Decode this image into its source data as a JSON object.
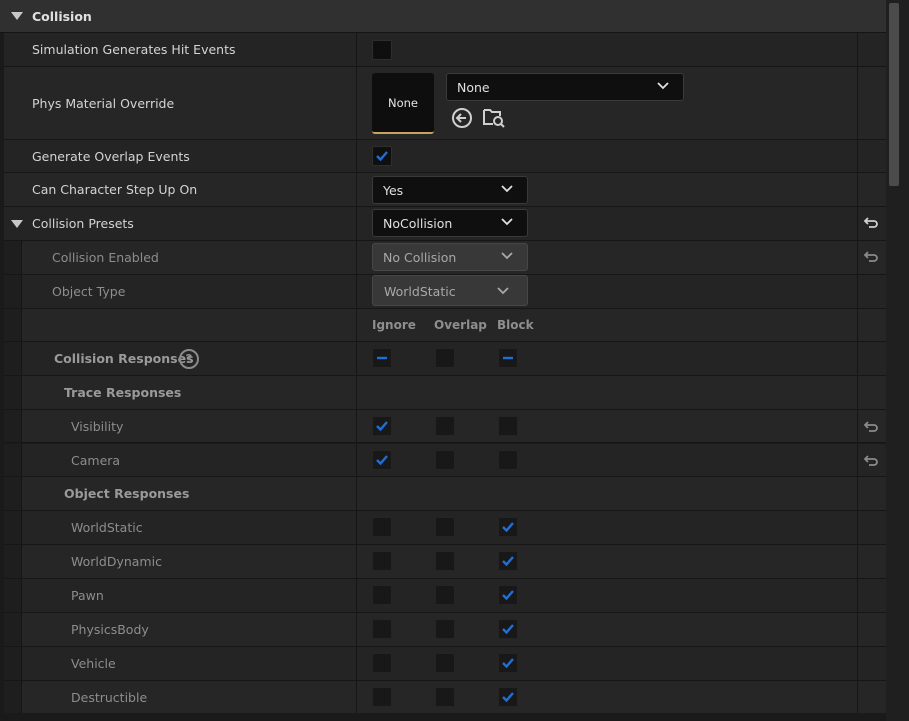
{
  "section": {
    "title": "Collision"
  },
  "rows": {
    "sim_hit": {
      "label": "Simulation Generates Hit Events",
      "checked": false
    },
    "phys_material": {
      "label": "Phys Material Override",
      "thumbnail_text": "None",
      "dropdown_value": "None",
      "icons": [
        "use-selected-icon",
        "browse-asset-icon"
      ]
    },
    "overlap": {
      "label": "Generate Overlap Events",
      "checked": true
    },
    "step_up": {
      "label": "Can Character Step Up On",
      "value": "Yes"
    },
    "presets": {
      "label": "Collision Presets",
      "value": "NoCollision"
    },
    "collision_enabled": {
      "label": "Collision Enabled",
      "value": "No Collision"
    },
    "object_type": {
      "label": "Object Type",
      "value": "WorldStatic"
    },
    "columns": {
      "ignore": "Ignore",
      "overlap": "Overlap",
      "block": "Block"
    },
    "responses": {
      "label": "Collision Responses",
      "help": "?"
    },
    "trace_header": {
      "label": "Trace Responses"
    },
    "object_header": {
      "label": "Object Responses"
    },
    "trace": [
      {
        "label": "Visibility",
        "ignore": true,
        "overlap": false,
        "block": false
      },
      {
        "label": "Camera",
        "ignore": true,
        "overlap": false,
        "block": false
      }
    ],
    "objects": [
      {
        "label": "WorldStatic",
        "ignore": false,
        "overlap": false,
        "block": true
      },
      {
        "label": "WorldDynamic",
        "ignore": false,
        "overlap": false,
        "block": true
      },
      {
        "label": "Pawn",
        "ignore": false,
        "overlap": false,
        "block": true
      },
      {
        "label": "PhysicsBody",
        "ignore": false,
        "overlap": false,
        "block": true
      },
      {
        "label": "Vehicle",
        "ignore": false,
        "overlap": false,
        "block": true
      },
      {
        "label": "Destructible",
        "ignore": false,
        "overlap": false,
        "block": true
      }
    ]
  },
  "colors": {
    "check": "#1e6fd9",
    "accent_underline": "#c8a35a",
    "background": "#242424"
  }
}
